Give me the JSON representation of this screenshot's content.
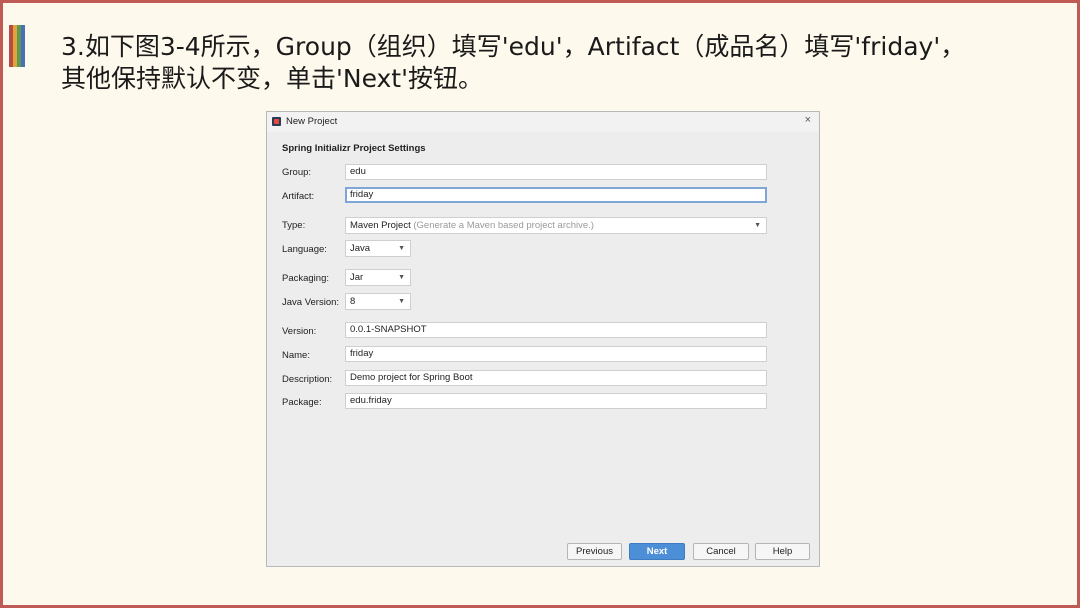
{
  "slide": {
    "heading_line1": "3.如下图3-4所示，Group（组织）填写'edu'，Artifact（成品名）填写'friday'，",
    "heading_line2": "其他保持默认不变，单击'Next'按钮。",
    "accent_colors": [
      "#b94a45",
      "#e3a33a",
      "#5c9a4f",
      "#4a6fb5"
    ],
    "frame_color": "#c05a54"
  },
  "dialog": {
    "title": "New Project",
    "section_title": "Spring Initializr Project Settings",
    "fields": {
      "group_label": "Group:",
      "group_value": "edu",
      "artifact_label": "Artifact:",
      "artifact_value": "friday",
      "type_label": "Type:",
      "type_value": "Maven Project",
      "type_hint": "(Generate a Maven based project archive.)",
      "language_label": "Language:",
      "language_value": "Java",
      "packaging_label": "Packaging:",
      "packaging_value": "Jar",
      "java_version_label": "Java Version:",
      "java_version_value": "8",
      "version_label": "Version:",
      "version_value": "0.0.1-SNAPSHOT",
      "name_label": "Name:",
      "name_value": "friday",
      "description_label": "Description:",
      "description_value": "Demo project for Spring Boot",
      "package_label": "Package:",
      "package_value": "edu.friday"
    },
    "buttons": {
      "previous": "Previous",
      "next": "Next",
      "cancel": "Cancel",
      "help": "Help"
    },
    "accent_color": "#4c8fd6"
  }
}
